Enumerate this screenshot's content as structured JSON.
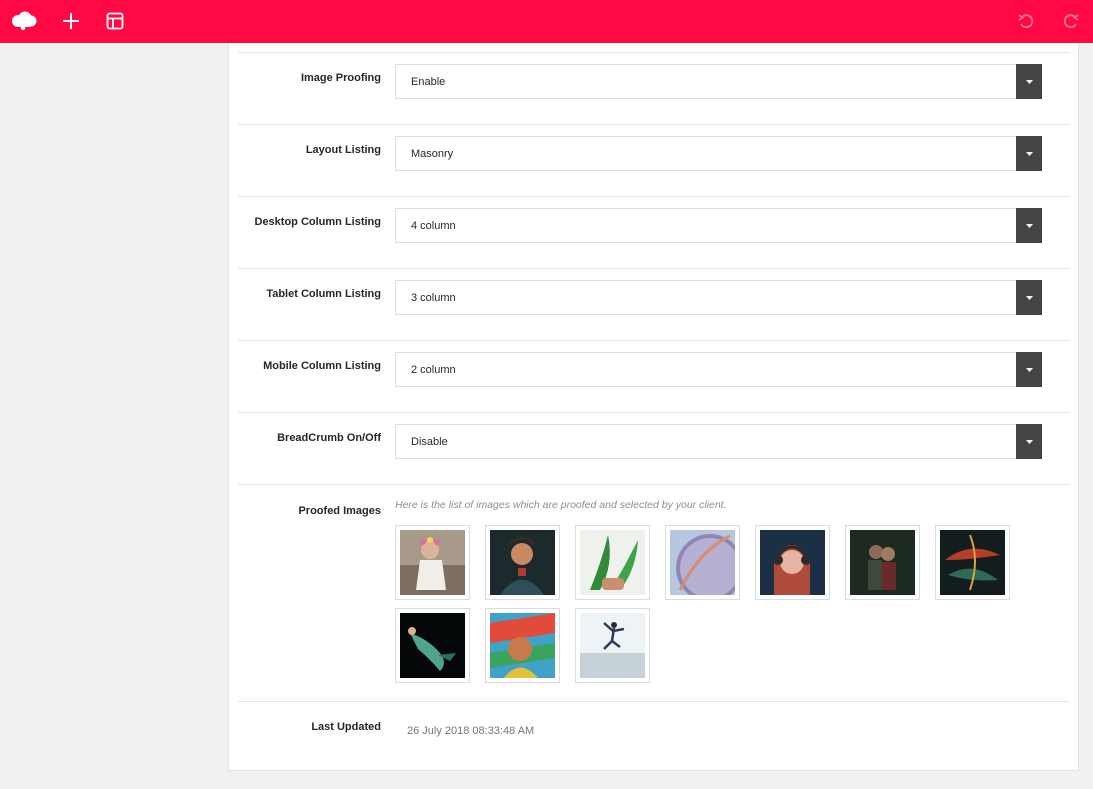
{
  "toolbar": {
    "logo_icon": "cloud-logo-icon",
    "add_icon": "plus-icon",
    "layout_icon": "layout-icon",
    "undo_icon": "undo-icon",
    "redo_icon": "redo-icon",
    "accent_color": "#ff0843"
  },
  "settings": [
    {
      "label": "Image Proofing",
      "value": "Enable"
    },
    {
      "label": "Layout Listing",
      "value": "Masonry"
    },
    {
      "label": "Desktop Column Listing",
      "value": "4 column"
    },
    {
      "label": "Tablet Column Listing",
      "value": "3 column"
    },
    {
      "label": "Mobile Column Listing",
      "value": "2 column"
    },
    {
      "label": "BreadCrumb On/Off",
      "value": "Disable"
    }
  ],
  "proofed": {
    "label": "Proofed Images",
    "note": "Here is the list of images which are proofed and selected by your client.",
    "images": [
      "woman-flower-crown",
      "man-portrait",
      "fern-leaves",
      "lavender-plate",
      "woman-headphones",
      "couple-dark",
      "tropical-leaves",
      "underwater-diver",
      "colorful-painted-woman",
      "person-jumping-snow"
    ]
  },
  "last_updated": {
    "label": "Last Updated",
    "value": "26 July 2018 08:33:48 AM"
  }
}
